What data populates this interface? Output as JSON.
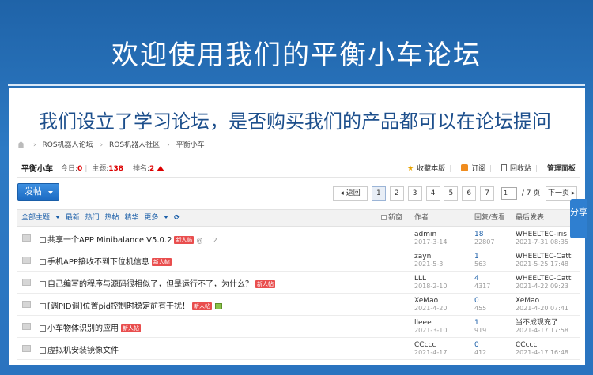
{
  "banner": {
    "title": "欢迎使用我们的平衡小车论坛"
  },
  "subtitle": "我们设立了学习论坛，是否购买我们的产品都可以在论坛提问",
  "breadcrumb": [
    "ROS机器人论坛",
    "ROS机器人社区",
    "平衡小车"
  ],
  "forum": {
    "name": "平衡小车",
    "today_label": "今日:",
    "today": "0",
    "topics_label": "主题:",
    "topics": "138",
    "rank_label": "排名:",
    "rank": "2",
    "actions": {
      "favorite": "收藏本版",
      "subscribe": "订阅",
      "recycle": "回收站",
      "manage": "管理面板"
    }
  },
  "post_button": "发帖",
  "pager": {
    "back": "返回",
    "pages": [
      "1",
      "2",
      "3",
      "4",
      "5",
      "6",
      "7"
    ],
    "current": "1",
    "input_value": "1",
    "total": "/ 7 页",
    "next": "下一页"
  },
  "table_head": {
    "filters": [
      "全部主题",
      "最新",
      "热门",
      "热帖",
      "精华",
      "更多"
    ],
    "refresh": "⟳",
    "new_window": "新窗",
    "author": "作者",
    "reply_view": "回复/查看",
    "last_post": "最后发表"
  },
  "rows": [
    {
      "title": "共享一个APP Minibalance V5.0.2",
      "badge": "新人帖",
      "extra": "@ … 2",
      "author": "admin",
      "date": "2017-3-14",
      "replies": "18",
      "views": "22807",
      "last_user": "WHEELTEC-iris",
      "last_time": "2021-7-31 08:35"
    },
    {
      "title": "手机APP接收不到下位机信息",
      "badge": "新人帖",
      "extra": "",
      "author": "zayn",
      "date": "2021-5-3",
      "replies": "1",
      "views": "563",
      "last_user": "WHEELTEC-Catt",
      "last_time": "2021-5-25 17:48"
    },
    {
      "title": "自己编写的程序与源码很相似了，但是运行不了，为什么？",
      "badge": "新人帖",
      "extra": "",
      "author": "LLL",
      "date": "2018-2-10",
      "replies": "4",
      "views": "4317",
      "last_user": "WHEELTEC-Catt",
      "last_time": "2021-4-22 09:23"
    },
    {
      "title": "[调PID调]位置pid控制时稳定前有干扰！",
      "badge": "新人帖",
      "extra": "",
      "author": "XeMao",
      "date": "2021-4-20",
      "replies": "0",
      "views": "455",
      "last_user": "XeMao",
      "last_time": "2021-4-20 07:41"
    },
    {
      "title": "小车物体识别的应用",
      "badge": "新人帖",
      "extra": "",
      "author": "lleee",
      "date": "2021-3-10",
      "replies": "1",
      "views": "919",
      "last_user": "当不成现充了",
      "last_time": "2021-4-17 17:58"
    },
    {
      "title": "虚拟机安装镜像文件",
      "badge": "",
      "extra": "",
      "author": "CCccc",
      "date": "2021-4-17",
      "replies": "0",
      "views": "412",
      "last_user": "CCccc",
      "last_time": "2021-4-17 16:48"
    }
  ],
  "share": "分享"
}
